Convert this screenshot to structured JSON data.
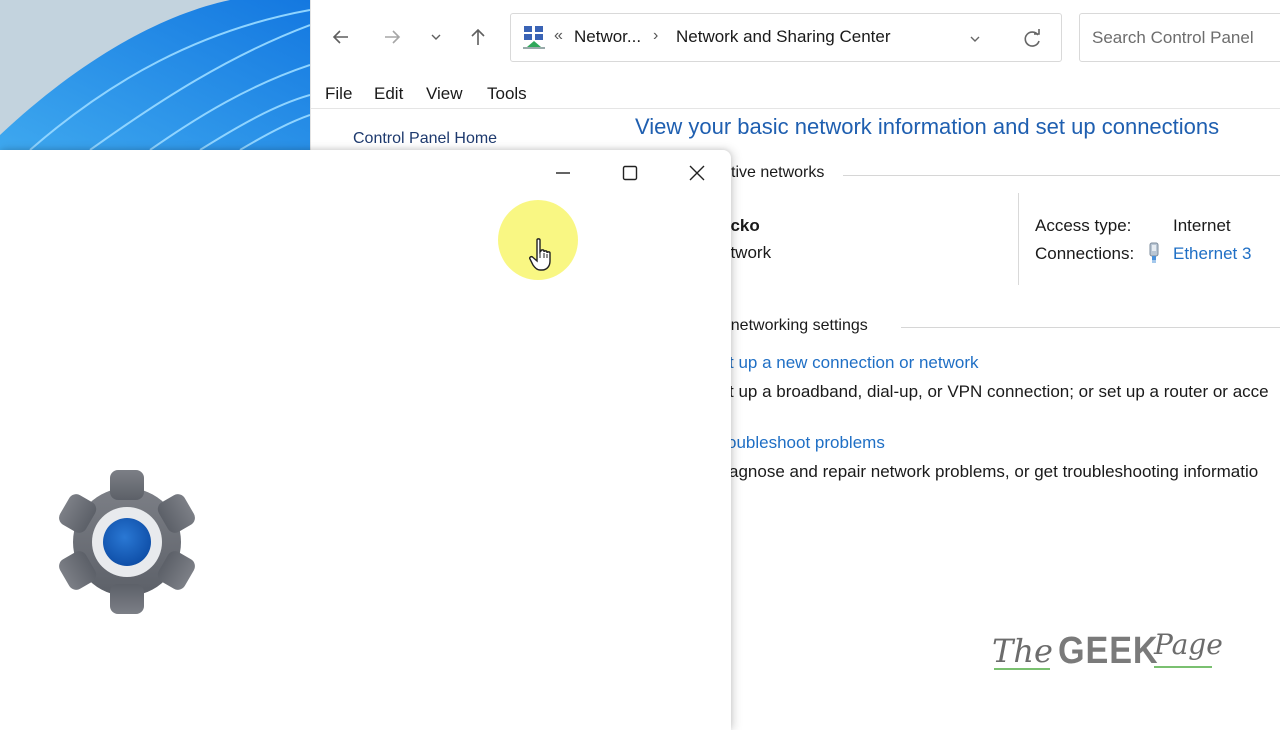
{
  "control_panel": {
    "nav": {
      "back_icon": "arrow-left-icon",
      "forward_icon": "arrow-right-icon",
      "recent_icon": "chevron-down-icon",
      "up_icon": "arrow-up-icon"
    },
    "address_bar": {
      "overflow": "«",
      "crumbs": [
        "Networ...",
        "Network and Sharing Center"
      ],
      "separator": "›",
      "dropdown_icon": "chevron-down-icon",
      "refresh_icon": "refresh-icon"
    },
    "search": {
      "placeholder": "Search Control Panel"
    },
    "menu": [
      "File",
      "Edit",
      "View",
      "Tools"
    ],
    "sidebar": {
      "home_link": "Control Panel Home"
    },
    "heading": "View your basic network information and set up connections",
    "active_networks": {
      "label": "tive networks",
      "network_name": "ecko",
      "network_type": "etwork",
      "access_type_label": "Access type:",
      "access_type_value": "Internet",
      "connections_label": "Connections:",
      "connections_value": "Ethernet 3"
    },
    "change_settings": {
      "label": "r networking settings",
      "tasks": [
        {
          "link": "t up a new connection or network",
          "description": "t up a broadband, dial-up, or VPN connection; or set up a router or acce"
        },
        {
          "link": "oubleshoot problems",
          "description": "agnose and repair network problems, or get troubleshooting informatio"
        }
      ]
    }
  },
  "settings_window": {
    "minimize_icon": "minimize-icon",
    "maximize_icon": "maximize-icon",
    "close_icon": "close-icon",
    "app_icon": "settings-gear-icon"
  },
  "watermark": {
    "the": "The",
    "geek": "GEEK",
    "page": "Page"
  },
  "colors": {
    "link": "#1f6fc5",
    "heading": "#1f5fb0",
    "cursor_halo": "#f8f678",
    "gear_center": "#1560c0"
  }
}
